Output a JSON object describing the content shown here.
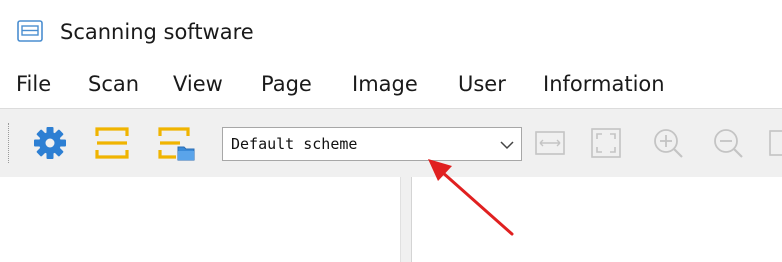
{
  "window": {
    "title": "Scanning software",
    "app_icon": "scanner-app-icon"
  },
  "menubar": {
    "items": [
      {
        "label": "File"
      },
      {
        "label": "Scan"
      },
      {
        "label": "View"
      },
      {
        "label": "Page"
      },
      {
        "label": "Image"
      },
      {
        "label": "User"
      },
      {
        "label": "Information"
      }
    ]
  },
  "toolbar": {
    "buttons": [
      {
        "icon": "gear-icon"
      },
      {
        "icon": "scan-area-icon"
      },
      {
        "icon": "scan-to-folder-icon"
      }
    ],
    "scheme_select": {
      "value": "Default scheme",
      "arrow_icon": "chevron-down-icon"
    },
    "view_buttons": [
      {
        "icon": "fit-width-icon"
      },
      {
        "icon": "fit-page-icon"
      },
      {
        "icon": "zoom-in-icon"
      },
      {
        "icon": "zoom-out-icon"
      }
    ]
  },
  "colors": {
    "accent_blue": "#2d7fd3",
    "scan_yellow": "#f0b400",
    "annotation_red": "#e02020",
    "toolbar_bg": "#f0f0f0",
    "disabled_icon": "#c4c4c4"
  }
}
